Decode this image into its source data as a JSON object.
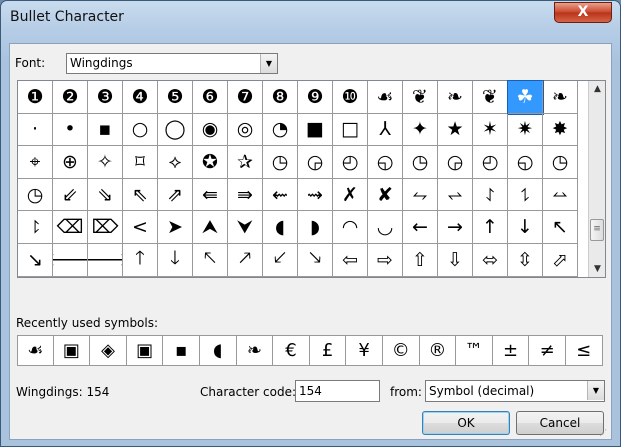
{
  "window": {
    "title": "Bullet Character",
    "close_glyph": "X"
  },
  "font": {
    "label": "Font:",
    "value": "Wingdings"
  },
  "grid": {
    "rows": [
      [
        "❶",
        "❷",
        "❸",
        "❹",
        "❺",
        "❻",
        "❼",
        "❽",
        "❾",
        "❿",
        "☙",
        "❦",
        "❧",
        "❦",
        "☘",
        "❧",
        "☙",
        "❦"
      ],
      [
        "·",
        "•",
        "▪",
        "○",
        "◯",
        "◉",
        "◎",
        "◔",
        "■",
        "□",
        "⅄",
        "✦",
        "★",
        "✶",
        "✷",
        "✸",
        "✵"
      ],
      [
        "⌖",
        "⊕",
        "✧",
        "⌑",
        "⟡",
        "✪",
        "✰",
        "◷",
        "◶",
        "◴",
        "◵",
        "◷",
        "◶",
        "◴",
        "◵",
        "◷"
      ],
      [
        "◷",
        "⇙",
        "⇘",
        "⇖",
        "⇗",
        "⇚",
        "⇛",
        "⇜",
        "⇝",
        "✗",
        "✘",
        "⥊",
        "⥋",
        "⥌",
        "⥍",
        "⥎"
      ],
      [
        "⥏",
        "⌫",
        "⌦",
        "<",
        "➤",
        "⮝",
        "⮟",
        "◖",
        "◗",
        "◠",
        "◡",
        "←",
        "→",
        "↑",
        "↓",
        "↖"
      ],
      [
        "↘",
        "🡐",
        "🡒",
        "🡑",
        "🡓",
        "🡔",
        "🡕",
        "🡗",
        "🡖",
        "⇦",
        "⇨",
        "⇧",
        "⇩",
        "⬄",
        "⇳",
        "⬀"
      ]
    ],
    "selected_index": 14
  },
  "recent": {
    "label": "Recently used symbols:",
    "symbols": [
      "☙",
      "▣",
      "◈",
      "▣",
      "▪",
      "◖",
      "❧",
      "€",
      "£",
      "¥",
      "©",
      "®",
      "™",
      "±",
      "≠",
      "≤",
      "≥",
      "÷"
    ]
  },
  "info": {
    "current": "Wingdings: 154",
    "code_label": "Character code:",
    "code_value": "154",
    "from_label": "from:",
    "from_value": "Symbol (decimal)"
  },
  "buttons": {
    "ok": "OK",
    "cancel": "Cancel"
  }
}
